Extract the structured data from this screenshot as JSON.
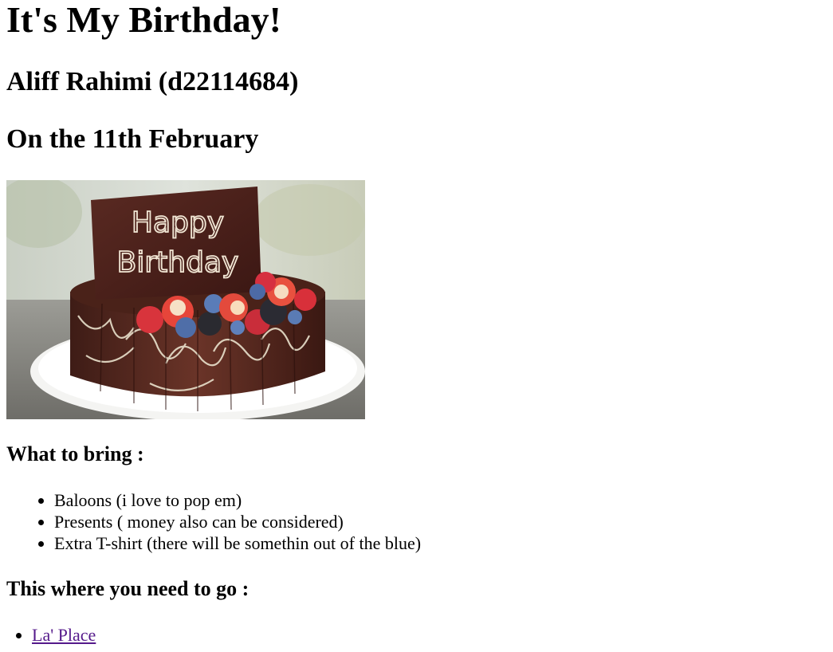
{
  "page": {
    "title": "It's My Birthday!",
    "name": "Aliff Rahimi (d22114684)",
    "date": "On the 11th February"
  },
  "cake_image": {
    "description_icon": "birthday-cake-image",
    "plaque_text_line1": "Happy",
    "plaque_text_line2": "Birthday"
  },
  "bring": {
    "heading": "What to bring :",
    "items": [
      "Baloons (i love to pop em)",
      "Presents ( money also can be considered)",
      "Extra T-shirt (there will be somethin out of the blue)"
    ]
  },
  "location": {
    "heading": "This where you need to go :",
    "link_label": "La' Place"
  },
  "colors": {
    "visited_link": "#551a8b",
    "text": "#000000",
    "background": "#ffffff"
  }
}
